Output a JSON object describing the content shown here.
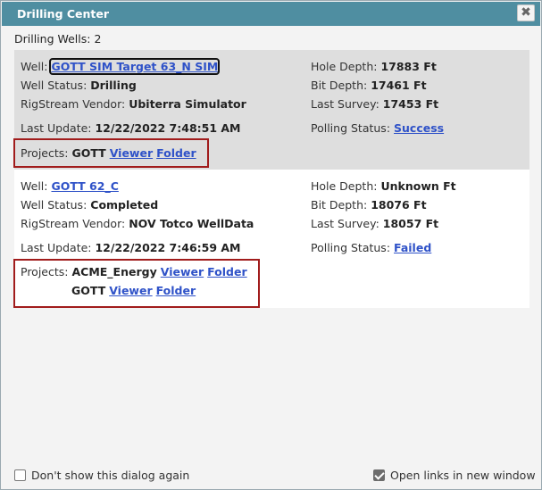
{
  "dialog": {
    "title": "Drilling Center",
    "close_glyph": "✖"
  },
  "summary": {
    "label": "Drilling Wells:",
    "count": "2"
  },
  "labels": {
    "well": "Well:",
    "well_status": "Well Status:",
    "rigstream_vendor": "RigStream Vendor:",
    "last_update": "Last Update:",
    "hole_depth": "Hole Depth:",
    "bit_depth": "Bit Depth:",
    "last_survey": "Last Survey:",
    "polling_status": "Polling Status:",
    "projects": "Projects:",
    "viewer": "Viewer",
    "folder": "Folder"
  },
  "wells": [
    {
      "name": "GOTT SIM Target 63_N SIM",
      "status": "Drilling",
      "vendor": "Ubiterra Simulator",
      "last_update": "12/22/2022 7:48:51 AM",
      "hole_depth": "17883 Ft",
      "bit_depth": "17461 Ft",
      "last_survey": "17453 Ft",
      "polling_status": "Success",
      "projects": [
        "GOTT"
      ]
    },
    {
      "name": "GOTT 62_C",
      "status": "Completed",
      "vendor": "NOV Totco WellData",
      "last_update": "12/22/2022 7:46:59 AM",
      "hole_depth": "Unknown Ft",
      "bit_depth": "18076 Ft",
      "last_survey": "18057 Ft",
      "polling_status": "Failed",
      "projects": [
        "ACME_Energy",
        "GOTT"
      ]
    }
  ],
  "footer": {
    "dont_show_label": "Don't show this dialog again",
    "dont_show_checked": false,
    "open_links_label": "Open links in new window",
    "open_links_checked": true
  },
  "colors": {
    "titlebar": "#4f8ea1",
    "link": "#2f52c8",
    "highlight_border": "#a11c1c",
    "panel1_bg": "#dedede"
  }
}
